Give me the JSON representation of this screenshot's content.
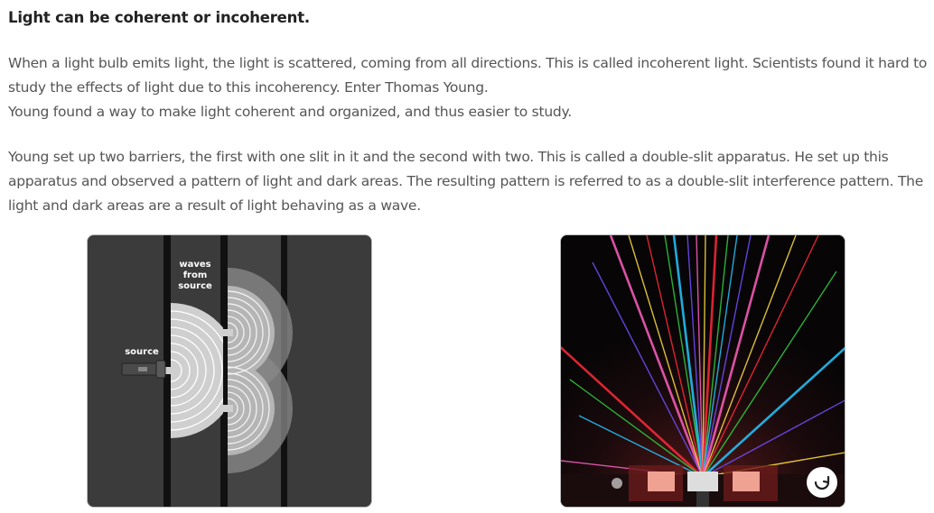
{
  "heading": "Light can be coherent or incoherent.",
  "paragraph1": {
    "lines": [
      "When a light bulb emits light, the light is scattered, coming from all directions. This is called incoherent light. Scientists found it hard to",
      "study the effects of light due to this incoherency. Enter Thomas Young.",
      "Young found a way to make light coherent and organized, and thus easier to study."
    ]
  },
  "paragraph2": {
    "lines": [
      "Young set up two barriers, the first with one slit in it and the second with two. This is called a double-slit apparatus. He set up this",
      "apparatus and observed a pattern of light and dark areas. The resulting pattern is referred to as a double-slit interference pattern. The",
      "light and dark areas are a result of light behaving as a wave."
    ]
  },
  "diagram": {
    "waves_label_1": "waves",
    "waves_label_2": "from",
    "waves_label_3": "source",
    "source_label": "source"
  },
  "photo": {
    "replay_icon": "replay-icon",
    "beam_colors": [
      "#ff2a3a",
      "#30d040",
      "#25c8ff",
      "#7050ff",
      "#ff60c0",
      "#ffe040"
    ]
  }
}
